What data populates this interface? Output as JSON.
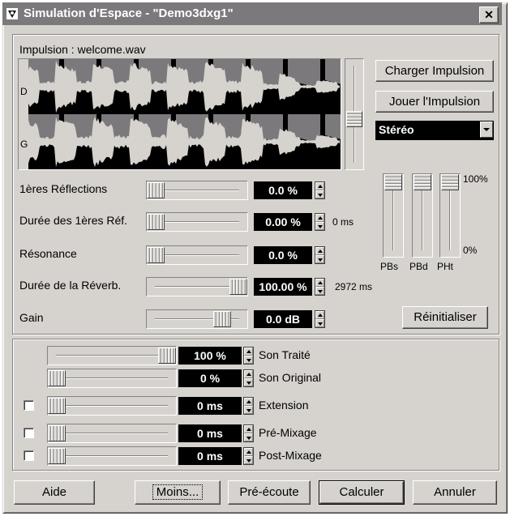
{
  "window": {
    "title": "Simulation d'Espace - \"Demo3dxg1\"",
    "close_glyph": "✕"
  },
  "impulse": {
    "label": "Impulsion : welcome.wav",
    "channel_left": "D",
    "channel_right": "G",
    "load_button": "Charger Impulsion",
    "play_button": "Jouer l'Impulsion",
    "mode_value": "Stéréo",
    "scroll_level": 0.55
  },
  "params": [
    {
      "label": "1ères Réflections",
      "value": "0.0 %",
      "extra": "",
      "level": 0.0
    },
    {
      "label": "Durée des 1ères Réf.",
      "value": "0.00 %",
      "extra": "0 ms",
      "level": 0.0
    },
    {
      "label": "Résonance",
      "value": "0.0 %",
      "extra": "",
      "level": 0.0
    },
    {
      "label": "Durée de la Réverb.",
      "value": "100.00 %",
      "extra": "2972 ms",
      "level": 1.0
    },
    {
      "label": "Gain",
      "value": "0.0 dB",
      "extra": "",
      "level": 0.8
    }
  ],
  "eq": {
    "max_label": "100%",
    "min_label": "0%",
    "bands": [
      {
        "label": "PBs",
        "level": 1.0
      },
      {
        "label": "PBd",
        "level": 1.0
      },
      {
        "label": "PHt",
        "level": 1.0
      }
    ],
    "reset_button": "Réinitialiser"
  },
  "mix": [
    {
      "label": "Son Traité",
      "value": "100 %",
      "checkbox": false,
      "level": 1.0
    },
    {
      "label": "Son Original",
      "value": "0 %",
      "checkbox": false,
      "level": 0.0
    },
    {
      "label": "Extension",
      "value": "0 ms",
      "checkbox": true,
      "checked": false,
      "level": 0.0
    },
    {
      "label": "Pré-Mixage",
      "value": "0 ms",
      "checkbox": true,
      "checked": false,
      "level": 0.0
    },
    {
      "label": "Post-Mixage",
      "value": "0 ms",
      "checkbox": true,
      "checked": false,
      "level": 0.0
    }
  ],
  "footer": {
    "help": "Aide",
    "less": "Moins...",
    "preview": "Pré-écoute",
    "compute": "Calculer",
    "cancel": "Annuler"
  },
  "colors": {
    "face": "#d6d3ce",
    "title_bg": "#7b797b",
    "wave_fg": "#d6d3ce",
    "wave_mid": "#7b797b",
    "wave_bg": "#000000"
  }
}
